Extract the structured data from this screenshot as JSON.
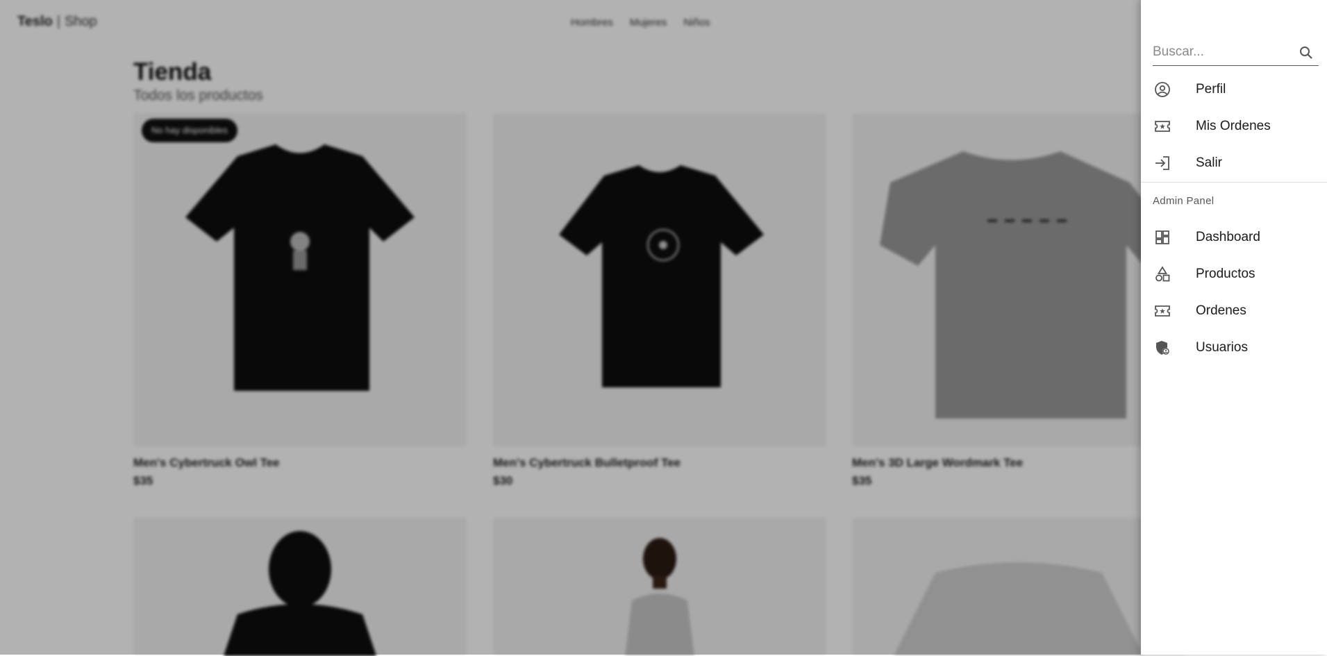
{
  "header": {
    "logo_brand": "Teslo",
    "logo_separator": "|",
    "logo_shop": "Shop",
    "nav": [
      "Hombres",
      "Mujeres",
      "Niños"
    ]
  },
  "page": {
    "title": "Tienda",
    "subtitle": "Todos los productos"
  },
  "products": [
    {
      "name": "Men's Cybertruck Owl Tee",
      "price": "$35",
      "badge": "No hay disponibles"
    },
    {
      "name": "Men's Cybertruck Bulletproof Tee",
      "price": "$30"
    },
    {
      "name": "Men's 3D Large Wordmark Tee",
      "price": "$35"
    }
  ],
  "sidemenu": {
    "search_placeholder": "Buscar...",
    "items": [
      {
        "label": "Perfil",
        "icon": "account-circle-icon"
      },
      {
        "label": "Mis Ordenes",
        "icon": "ticket-icon"
      },
      {
        "label": "Salir",
        "icon": "login-icon"
      }
    ],
    "admin_header": "Admin Panel",
    "admin_items": [
      {
        "label": "Dashboard",
        "icon": "dashboard-icon"
      },
      {
        "label": "Productos",
        "icon": "category-icon"
      },
      {
        "label": "Ordenes",
        "icon": "ticket-icon"
      },
      {
        "label": "Usuarios",
        "icon": "admin-shield-icon"
      }
    ]
  }
}
